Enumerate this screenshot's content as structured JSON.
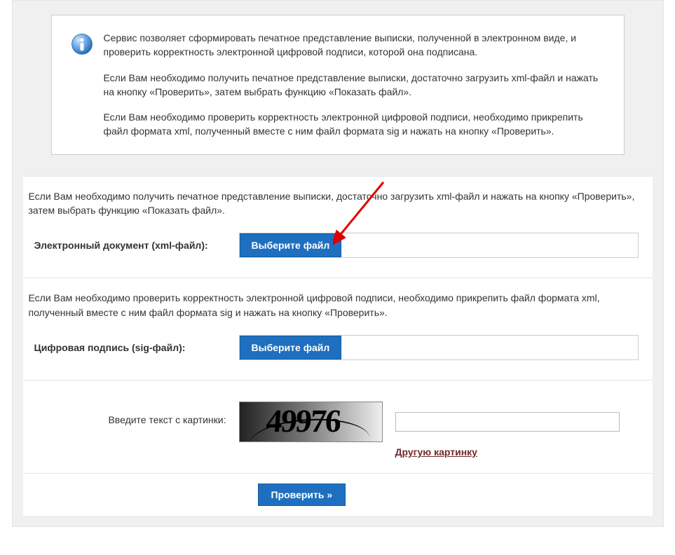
{
  "info": {
    "p1": "Сервис позволяет сформировать печатное представление выписки, полученной в электронном виде, и проверить корректность электронной цифровой подписи, которой она подписана.",
    "p2": "Если Вам необходимо получить печатное представление выписки, достаточно загрузить xml-файл и нажать на кнопку «Проверить», затем выбрать функцию «Показать файл».",
    "p3": "Если Вам необходимо проверить корректность электронной цифровой подписи, необходимо прикрепить файл формата xml, полученный вместе с ним файл формата sig и нажать на кнопку «Проверить»."
  },
  "xml": {
    "desc": "Если Вам необходимо получить печатное представление выписки, достаточно загрузить xml-файл и нажать на кнопку «Проверить», затем выбрать функцию «Показать файл».",
    "label": "Электронный документ (xml-файл):",
    "button": "Выберите файл"
  },
  "sig": {
    "desc": "Если Вам необходимо проверить корректность электронной цифровой подписи, необходимо прикрепить файл формата xml, полученный вместе с ним файл формата sig и нажать на кнопку «Проверить».",
    "label": "Цифровая подпись (sig-файл):",
    "button": "Выберите файл"
  },
  "captcha": {
    "label": "Введите текст с картинки:",
    "code": "49976",
    "another": "Другую картинку",
    "value": ""
  },
  "submit": {
    "label": "Проверить »"
  }
}
